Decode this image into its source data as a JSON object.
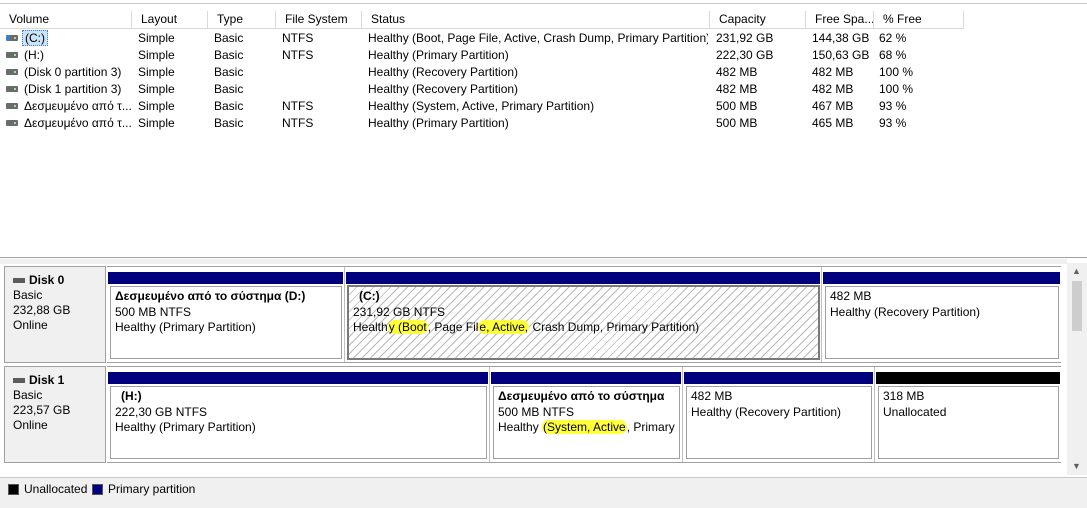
{
  "volume_list": {
    "columns": [
      "Volume",
      "Layout",
      "Type",
      "File System",
      "Status",
      "Capacity",
      "Free Spa...",
      "% Free"
    ],
    "rows": [
      {
        "volume": "(C:)",
        "layout": "Simple",
        "type": "Basic",
        "fs": "NTFS",
        "status": "Healthy (Boot, Page File, Active, Crash Dump, Primary Partition)",
        "capacity": "231,92 GB",
        "free": "144,38 GB",
        "pct": "62 %",
        "icon": "system-drive-icon"
      },
      {
        "volume": "(H:)",
        "layout": "Simple",
        "type": "Basic",
        "fs": "NTFS",
        "status": "Healthy (Primary Partition)",
        "capacity": "222,30 GB",
        "free": "150,63 GB",
        "pct": "68 %",
        "icon": "drive-icon"
      },
      {
        "volume": "(Disk 0 partition 3)",
        "layout": "Simple",
        "type": "Basic",
        "fs": "",
        "status": "Healthy (Recovery Partition)",
        "capacity": "482 MB",
        "free": "482 MB",
        "pct": "100 %",
        "icon": "drive-icon"
      },
      {
        "volume": "(Disk 1 partition 3)",
        "layout": "Simple",
        "type": "Basic",
        "fs": "",
        "status": "Healthy (Recovery Partition)",
        "capacity": "482 MB",
        "free": "482 MB",
        "pct": "100 %",
        "icon": "drive-icon"
      },
      {
        "volume": "Δεσμευμένο από τ...",
        "layout": "Simple",
        "type": "Basic",
        "fs": "NTFS",
        "status": "Healthy (System, Active, Primary Partition)",
        "capacity": "500 MB",
        "free": "467 MB",
        "pct": "93 %",
        "icon": "drive-icon"
      },
      {
        "volume": "Δεσμευμένο από τ...",
        "layout": "Simple",
        "type": "Basic",
        "fs": "NTFS",
        "status": "Healthy (Primary Partition)",
        "capacity": "500 MB",
        "free": "465 MB",
        "pct": "93 %",
        "icon": "drive-icon"
      }
    ]
  },
  "disks": [
    {
      "name": "Disk 0",
      "kind": "Basic",
      "size": "232,88 GB",
      "state": "Online",
      "partitions": [
        {
          "title": "Δεσμευμένο από το σύστημα  (D:)",
          "size": "500 MB NTFS",
          "status": "Healthy (Primary Partition)"
        },
        {
          "title": "(C:)",
          "size": "231,92 GB NTFS",
          "status_parts": [
            "Health",
            "y ",
            "(Boot",
            ", Page Fil",
            "e, ",
            "Active,",
            " Crash Dump, Primary Partition)"
          ]
        },
        {
          "title": "",
          "size": "482 MB",
          "status": "Healthy (Recovery Partition)"
        }
      ]
    },
    {
      "name": "Disk 1",
      "kind": "Basic",
      "size": "223,57 GB",
      "state": "Online",
      "partitions": [
        {
          "title": "(H:)",
          "size": "222,30 GB NTFS",
          "status": "Healthy (Primary Partition)"
        },
        {
          "title": "Δεσμευμένο από το σύστημα",
          "size": "500 MB NTFS",
          "status_parts": [
            "Healthy ",
            "(System, Active",
            ", Primary I"
          ]
        },
        {
          "title": "",
          "size": "482 MB",
          "status": "Healthy (Recovery Partition)"
        },
        {
          "title": "",
          "size": "318 MB",
          "status": "Unallocated"
        }
      ]
    }
  ],
  "legend": {
    "unallocated": "Unallocated",
    "primary": "Primary partition"
  },
  "colors": {
    "primary": "#00007f",
    "unallocated": "#000000",
    "highlight": "#ffff3a"
  }
}
